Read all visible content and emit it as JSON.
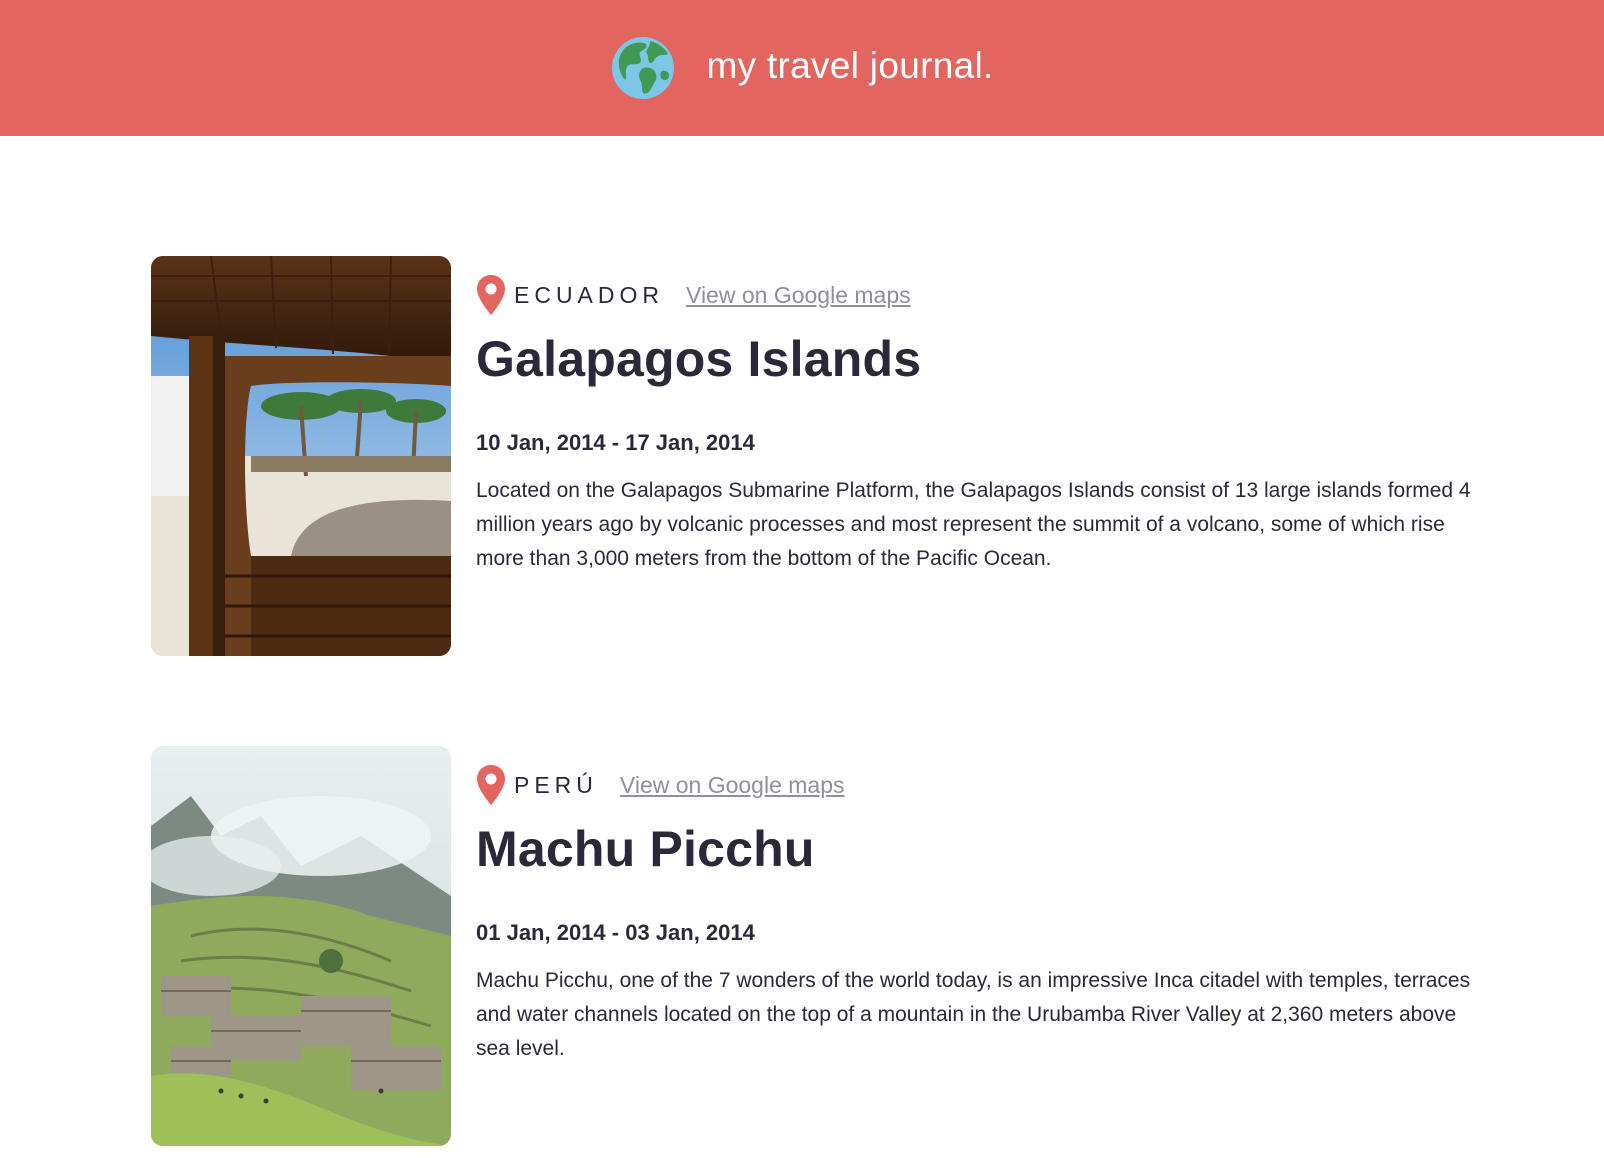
{
  "header": {
    "title": "my travel journal.",
    "icon": "globe-icon"
  },
  "colors": {
    "header_bg": "#e26560",
    "text": "#2b283a",
    "link": "#918e9b",
    "pin": "#e26560"
  },
  "entries": [
    {
      "country": "ECUADOR",
      "map_link": "View on Google maps",
      "place": "Galapagos Islands",
      "dates": "10 Jan, 2014 - 17 Jan, 2014",
      "description": "Located on the Galapagos Submarine Platform, the Galapagos Islands consist of 13 large islands formed 4 million years ago by volcanic processes and most represent the summit of a volcano, some of which rise more than 3,000 meters from the bottom of the Pacific Ocean.",
      "photo": "galapagos-photo"
    },
    {
      "country": "PERÚ",
      "map_link": "View on Google maps",
      "place": "Machu Picchu",
      "dates": "01 Jan, 2014 - 03 Jan, 2014",
      "description": "Machu Picchu, one of the 7 wonders of the world today, is an impressive Inca citadel with temples, terraces and water channels located on the top of a mountain in the Urubamba River Valley at 2,360 meters above sea level.",
      "photo": "machu-picchu-photo"
    }
  ]
}
